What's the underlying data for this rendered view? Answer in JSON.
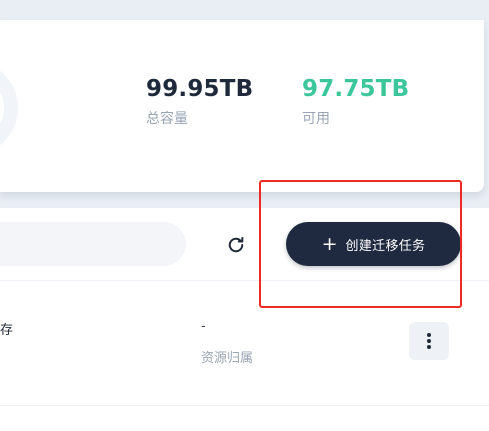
{
  "storage_summary": {
    "total_capacity": {
      "value": "99.95TB",
      "label": "总容量"
    },
    "available": {
      "value": "97.75TB",
      "label": "可用"
    },
    "colors": {
      "total": "#1e293b",
      "available": "#3cc79a"
    }
  },
  "toolbar": {
    "search": {
      "value": "",
      "placeholder": ""
    },
    "refresh_icon": "refresh-icon",
    "create_button": {
      "icon": "plus-icon",
      "label": "创建迁移任务",
      "color": "#1f2a40"
    }
  },
  "table": {
    "rows": [
      {
        "name": "存",
        "owner_value": "-",
        "owner_label": "资源归属",
        "actions_icon": "more-vertical-icon"
      }
    ]
  },
  "annotation": {
    "color": "#ee2a24"
  }
}
